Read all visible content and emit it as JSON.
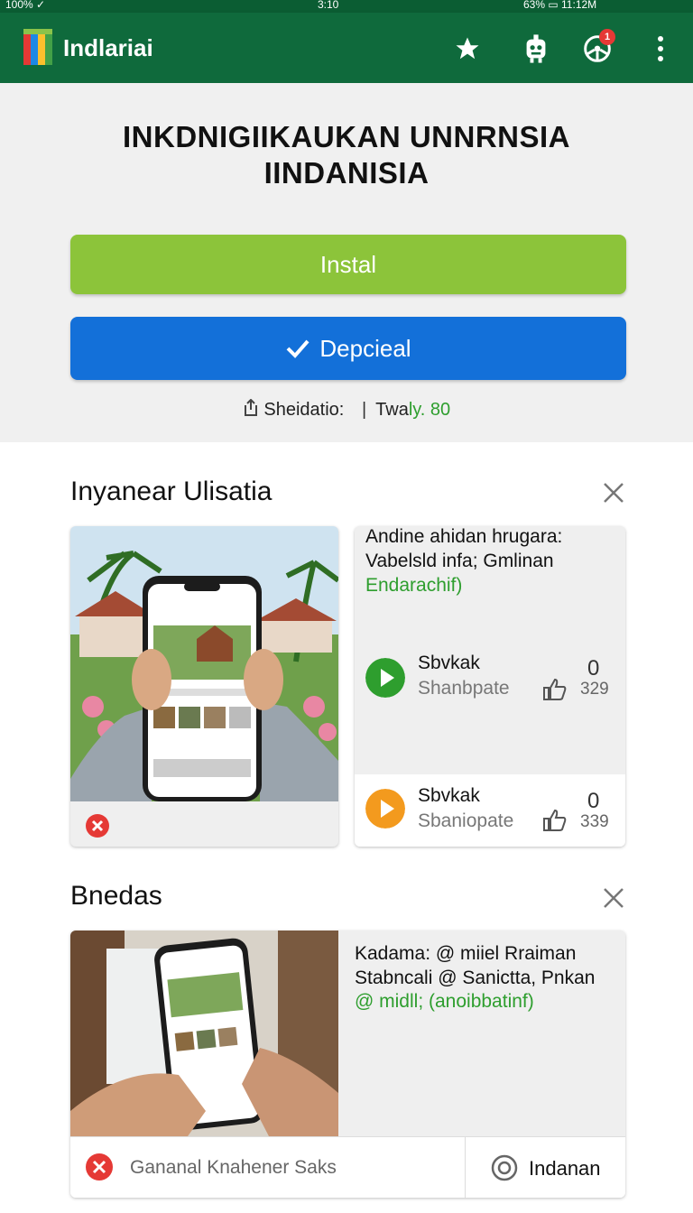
{
  "status_bar": {
    "left": "100% ✓",
    "center": "3:10",
    "right": "63% ▭ 11:12M"
  },
  "app": {
    "name": "Indlariai",
    "badge_count": "1"
  },
  "hero": {
    "title_line1": "INKDNIGIIKAUKAN UNNRNSIA",
    "title_line2": "IINDANISIA",
    "install_label": "Instal",
    "primary_label": "Depcieal",
    "meta_label": "Sheidatio:",
    "meta_sep": "|",
    "meta_value_prefix": "Twa",
    "meta_value_green": "ly. 80"
  },
  "section1": {
    "title": "Inyanear Ulisatia",
    "text_card": {
      "line1": "Andine ahidan hrugara:",
      "line2": "Vabelsld infa; Gmlinan",
      "line3": "Endarachif)"
    },
    "items": [
      {
        "title": "Sbvkak",
        "subtitle": "Shanbpate",
        "count_top": "0",
        "count_bottom": "329",
        "color": "#2e9e2e"
      },
      {
        "title": "Sbvkak",
        "subtitle": "Sbaniopate",
        "count_top": "0",
        "count_bottom": "339",
        "color": "#f39a1e"
      }
    ]
  },
  "section2": {
    "title": "Bnedas",
    "text_lines": {
      "line1": "Kadama: @ miiel Rraiman",
      "line2": "Stabncali @ Sanictta, Pnkan",
      "line3_prefix": "@ midll;",
      "line3_green": "(anoibbatinf)"
    },
    "footer_left": "Gananal Knahener Saks",
    "footer_right": "Indanan"
  },
  "colors": {
    "appbar": "#0f6a3c",
    "install": "#8cc43a",
    "primary": "#1370d9",
    "accent_green": "#2e9e2e",
    "accent_orange": "#f39a1e",
    "error_red": "#e53935"
  }
}
